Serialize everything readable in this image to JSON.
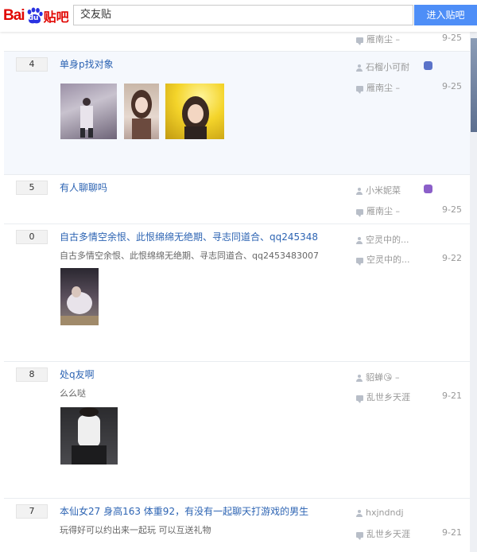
{
  "header": {
    "logo_bai": "Bai",
    "logo_du": "du",
    "logo_tieba": "贴吧",
    "search_value": "交友贴",
    "enter_label": "进入贴吧"
  },
  "top_partial": {
    "last_replier": "雁南尘 –",
    "date": "9-25"
  },
  "threads": [
    {
      "replies": "4",
      "title": "单身p找对象",
      "author": "石榴小可耐",
      "last_replier": "雁南尘 –",
      "date": "9-25"
    },
    {
      "replies": "5",
      "title": "有人聊聊吗",
      "author": "小米妮菜",
      "last_replier": "雁南尘 –",
      "date": "9-25"
    },
    {
      "replies": "0",
      "title": "自古多情空余恨、此恨绵绵无绝期、寻志同道合、qq245348",
      "abstract": "自古多情空余恨、此恨绵绵无绝期、寻志同道合、qq2453483007",
      "author": "空灵中的...",
      "last_replier": "空灵中的...",
      "date": "9-22"
    },
    {
      "replies": "8",
      "title": "处q友啊",
      "abstract": "么么哒",
      "author": "貂蝉😘 –",
      "last_replier": "乱世乡天涯",
      "date": "9-21"
    },
    {
      "replies": "7",
      "title": "本仙女27 身高163 体重92，有没有一起聊天打游戏的男生",
      "abstract": "玩得好可以约出来一起玩 可以互送礼物",
      "author": "hxjndndj",
      "last_replier": "乱世乡天涯",
      "date": "9-21"
    }
  ],
  "colors": {
    "link": "#2d64b3",
    "button": "#4e8ef7",
    "logo_red": "#e10602",
    "logo_blue": "#2932e1"
  }
}
